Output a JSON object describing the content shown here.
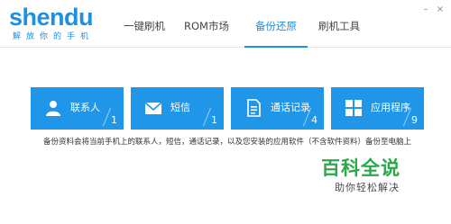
{
  "app": {
    "logo_text": "shendu",
    "logo_subtitle": "解放你的手机"
  },
  "nav": {
    "tabs": [
      {
        "label": "一键刷机"
      },
      {
        "label": "ROM市场"
      },
      {
        "label": "备份还原"
      },
      {
        "label": "刷机工具"
      }
    ],
    "active_tab": "备份还原"
  },
  "window_controls": {
    "minimize": "–",
    "close": "×"
  },
  "tiles": [
    {
      "label": "联系人",
      "count": "1",
      "icon": "person-icon"
    },
    {
      "label": "短信",
      "count": "1",
      "icon": "envelope-icon"
    },
    {
      "label": "通话记录",
      "count": "4",
      "icon": "document-icon"
    },
    {
      "label": "应用程序",
      "count": "9",
      "icon": "grid-icon"
    }
  ],
  "description": "备份资料会将当前手机上的联系人，短信，通话记录，以及您安装的应用软件（不含软件资料）备份至电脑上",
  "watermark": {
    "title": "百科全说",
    "subtitle": "助你轻松解决"
  },
  "colors": {
    "accent": "#1f96e8",
    "brand": "#1f8fe0",
    "watermark": "#2aa84a"
  }
}
